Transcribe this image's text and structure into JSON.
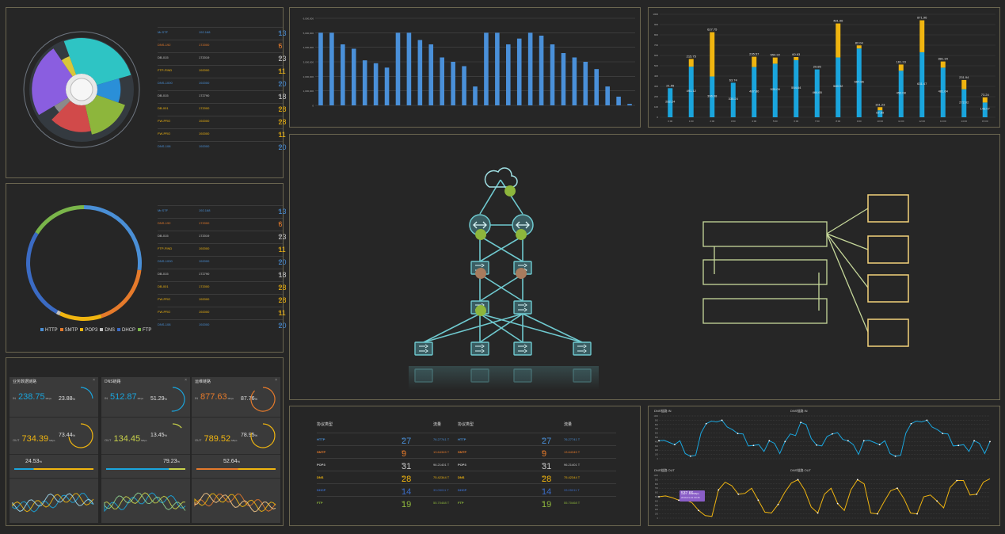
{
  "colors": {
    "panel_bg": "#262626",
    "border": "#6b6650",
    "blue": "#1aa5dd",
    "yellow": "#f0b510",
    "orange": "#e57a2b",
    "green": "#8db63c",
    "teal": "#6fc9cf",
    "cream": "#f3d27a"
  },
  "top_legend": {
    "rows": [
      {
        "name": "Mr.STF",
        "ip": "192.168",
        "count": "13",
        "unit": "%"
      },
      {
        "name": "DNS-192",
        "ip": "172000",
        "count": "6",
        "unit": "%"
      },
      {
        "name": "DB-015",
        "ip": "172019",
        "count": "23",
        "unit": "%"
      },
      {
        "name": "FTP-FIND",
        "ip": "192000",
        "count": "11",
        "unit": "%"
      },
      {
        "name": "DNS-1000",
        "ip": "192000",
        "count": "20",
        "unit": "%"
      },
      {
        "name": "DB-015",
        "ip": "172790",
        "count": "18",
        "unit": "%"
      },
      {
        "name": "DB-001",
        "ip": "172000",
        "count": "28",
        "unit": "%"
      },
      {
        "name": "FW-PRO",
        "ip": "192000",
        "count": "28",
        "unit": "%"
      },
      {
        "name": "FW-PRO",
        "ip": "192000",
        "count": "11",
        "unit": "%"
      },
      {
        "name": "DNS-108",
        "ip": "192000",
        "count": "20",
        "unit": "%"
      }
    ]
  },
  "donut_legend": [
    {
      "name": "HTTP",
      "color": "#4a8fd6"
    },
    {
      "name": "SMTP",
      "color": "#e57a2b"
    },
    {
      "name": "POP3",
      "color": "#f0b510"
    },
    {
      "name": "DNS",
      "color": "#c0c0c0"
    },
    {
      "name": "DHCP",
      "color": "#3b6bc4"
    },
    {
      "name": "FTP",
      "color": "#7ab54a"
    }
  ],
  "monitors": [
    {
      "title": "业务数据链路",
      "close": "×",
      "in_label": "IN",
      "in_value": "238.75",
      "in_unit": "Mbps",
      "in_pct": "23.88",
      "out_label": "OUT",
      "out_value": "734.39",
      "out_unit": "Mbps",
      "out_pct": "73.44",
      "total_pct": "24.53",
      "pct_unit": "%"
    },
    {
      "title": "DNS链路",
      "close": "×",
      "in_label": "IN",
      "in_value": "512.87",
      "in_unit": "Mbps",
      "in_pct": "51.29",
      "out_label": "OUT",
      "out_value": "134.45",
      "out_unit": "Mbps",
      "out_pct": "13.45",
      "total_pct": "79.23",
      "pct_unit": "%"
    },
    {
      "title": "运维链路",
      "close": "×",
      "in_label": "IN",
      "in_value": "877.63",
      "in_unit": "Mbps",
      "in_pct": "87.76",
      "out_label": "OUT",
      "out_value": "789.52",
      "out_unit": "Mbps",
      "out_pct": "78.95",
      "total_pct": "52.64",
      "pct_unit": "%"
    }
  ],
  "protocol_table": {
    "headers": [
      "协议类型",
      "",
      "流量"
    ],
    "unit_count": "%",
    "rows": [
      {
        "name": "HTTP",
        "count": "27",
        "traffic": "76.27741 T"
      },
      {
        "name": "SMTP",
        "count": "9",
        "traffic": "13.64345 T"
      },
      {
        "name": "POP3",
        "count": "31",
        "traffic": "96.21401 T"
      },
      {
        "name": "DNS",
        "count": "28",
        "traffic": "75.42344 T"
      },
      {
        "name": "DHCP",
        "count": "14",
        "traffic": "33.05011 T"
      },
      {
        "name": "FTP",
        "count": "19",
        "traffic": "55.70468 T"
      }
    ]
  },
  "line_charts": {
    "top_left_title": "DNS链路 IN",
    "top_right_title": "DNS链路 IN",
    "bottom_left_title": "DNS链路 OUT",
    "bottom_right_title": "DNS链路 OUT",
    "tooltip_value": "537.66",
    "tooltip_unit": "Mbps",
    "tooltip_time": "2019-01-01 00:45"
  },
  "chart_data": [
    {
      "type": "bar",
      "title": "",
      "ylabel": "",
      "xlabel": "",
      "ylim": [
        0,
        6000000
      ],
      "y_ticks": [
        "0",
        "1,000,000",
        "2,000,000",
        "3,000,000",
        "4,000,000",
        "5,000,000",
        "6,000,000"
      ],
      "values": [
        5000000,
        5000000,
        4200000,
        3900000,
        3100000,
        2900000,
        2600000,
        5000000,
        5000000,
        4500000,
        4200000,
        3300000,
        3000000,
        2700000,
        1300000,
        5000000,
        5000000,
        4200000,
        4600000,
        5000000,
        4800000,
        4200000,
        3600000,
        3300000,
        3000000,
        2500000,
        1300000,
        600000,
        100000
      ]
    },
    {
      "type": "bar",
      "title": "",
      "stacked": true,
      "ylim": [
        0,
        1000
      ],
      "y_ticks": [
        "0",
        "100",
        "200",
        "300",
        "400",
        "500",
        "600",
        "700",
        "800",
        "900",
        "1000"
      ],
      "categories": [
        "0:00",
        "1:00",
        "2:00",
        "3:00",
        "4:00",
        "5:00",
        "6:00",
        "7:00",
        "8:00",
        "9:00",
        "10:00",
        "11:00",
        "12:00",
        "13:00",
        "14:00",
        "15:00"
      ],
      "series": [
        {
          "values": [
            282.24,
            491.12,
            396.08,
            335.24,
            487.86,
            520.09,
            554.64,
            464.65,
            580.92,
            667.86,
            67.99,
            452.08,
            631.47,
            481.64,
            272.02,
            143.07
          ]
        },
        {
          "values": [
            0,
            75,
            430,
            0,
            100,
            60,
            30,
            0,
            330,
            30,
            30,
            60,
            310,
            60,
            90,
            50
          ]
        }
      ],
      "labels_top": [
        "21.55",
        "215.75",
        "627.75",
        "63.74",
        "235.57",
        "554.22",
        "60.63",
        "29.85",
        "481.96",
        "82.04",
        "161.23",
        "161.23",
        "871.96",
        "881.34",
        "231.94",
        "73.24"
      ]
    },
    {
      "type": "line",
      "title": "DNS链路 IN",
      "ylim": [
        0,
        1000
      ],
      "y_ticks": [
        "0",
        "100",
        "200",
        "300",
        "400",
        "500",
        "600",
        "700",
        "800",
        "900",
        "1000"
      ],
      "series": [
        {
          "values": [
            420,
            430,
            380,
            330,
            420,
            120,
            60,
            80,
            600,
            820,
            880,
            860,
            900,
            740,
            680,
            590,
            580,
            300,
            310,
            330,
            170,
            420,
            360,
            120,
            400,
            580,
            540,
            850,
            800,
            470,
            320,
            300,
            520,
            580,
            610,
            450,
            420,
            330,
            100,
            420,
            430,
            380,
            330,
            420,
            120,
            60,
            80,
            600,
            820,
            880,
            860,
            900,
            740,
            680,
            590,
            580,
            300,
            310,
            330,
            170,
            420,
            360,
            120,
            400
          ]
        }
      ]
    },
    {
      "type": "line",
      "title": "DNS链路 OUT",
      "ylim": [
        0,
        1000
      ],
      "y_ticks": [
        "0",
        "100",
        "200",
        "300",
        "400",
        "500",
        "600",
        "700",
        "800",
        "900",
        "1000"
      ],
      "series": [
        {
          "values": [
            500,
            520,
            480,
            420,
            430,
            360,
            180,
            60,
            40,
            660,
            840,
            760,
            560,
            580,
            700,
            420,
            140,
            120,
            320,
            600,
            820,
            900,
            660,
            260,
            120,
            560,
            700,
            340,
            180,
            660,
            900,
            800,
            120,
            100,
            380,
            640,
            700,
            460,
            120,
            100,
            500,
            540,
            400,
            240,
            720,
            880,
            880,
            540,
            560,
            840,
            920
          ]
        }
      ]
    },
    {
      "type": "pie",
      "title": "",
      "series": [
        {
          "name": "cyan",
          "value": 26,
          "radius": 1.0,
          "color": "#2ec4c4"
        },
        {
          "name": "blue",
          "value": 10,
          "radius": 0.65,
          "color": "#2a8fd8"
        },
        {
          "name": "green",
          "value": 16,
          "radius": 0.85,
          "color": "#8db63c"
        },
        {
          "name": "red",
          "value": 16,
          "radius": 0.75,
          "color": "#d14a4a"
        },
        {
          "name": "gray",
          "value": 4,
          "radius": 0.45,
          "color": "#8a8a8a"
        },
        {
          "name": "purple",
          "value": 24,
          "radius": 0.95,
          "color": "#8a5ee0"
        },
        {
          "name": "yellow",
          "value": 4,
          "radius": 0.55,
          "color": "#d9c63a"
        }
      ]
    },
    {
      "type": "pie",
      "title": "",
      "donut": true,
      "series": [
        {
          "name": "HTTP",
          "value": 27,
          "color": "#4a8fd6"
        },
        {
          "name": "SMTP",
          "value": 18,
          "color": "#e57a2b"
        },
        {
          "name": "POP3",
          "value": 12,
          "color": "#f0b510"
        },
        {
          "name": "DNS",
          "value": 1,
          "color": "#c0c0c0"
        },
        {
          "name": "DHCP",
          "value": 26,
          "color": "#3b6bc4"
        },
        {
          "name": "FTP",
          "value": 16,
          "color": "#7ab54a"
        }
      ]
    }
  ]
}
